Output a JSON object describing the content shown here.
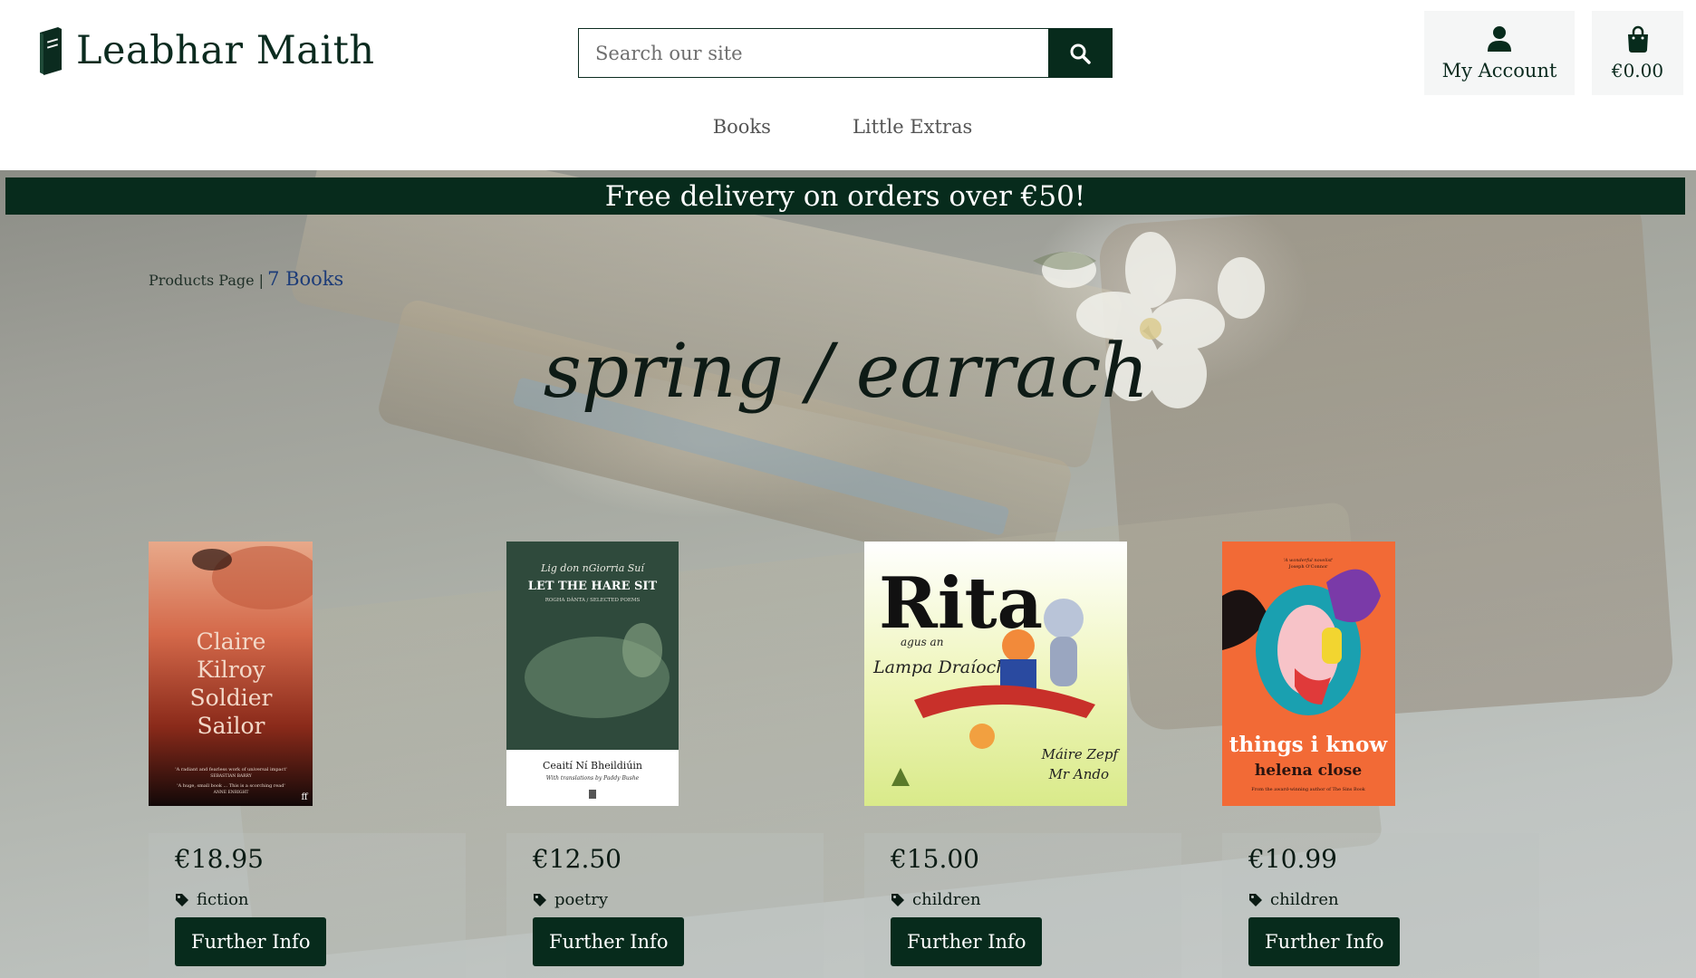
{
  "brand": {
    "name": "Leabhar Maith"
  },
  "search": {
    "placeholder": "Search our site"
  },
  "account": {
    "label": "My Account"
  },
  "cart": {
    "total": "€0.00"
  },
  "nav": [
    {
      "label": "Books"
    },
    {
      "label": "Little Extras"
    }
  ],
  "banner": {
    "text": "Free delivery on orders over €50!"
  },
  "breadcrumb": {
    "page": "Products Page |",
    "count": "7 Books"
  },
  "page_title": "spring / earrach",
  "products": [
    {
      "price": "€18.95",
      "tag": "fiction",
      "button": "Further Info",
      "cover": {
        "title_lines": [
          "Claire",
          "Kilroy",
          "Soldier",
          "Sailor"
        ],
        "quote1": "'A radiant and fearless work of universal impact'",
        "quote1_by": "SEBASTIAN BARRY",
        "quote2": "'A huge, small book ... This is a scorching read'",
        "quote2_by": "ANNE ENRIGHT"
      }
    },
    {
      "price": "€12.50",
      "tag": "poetry",
      "button": "Further Info",
      "cover": {
        "irish_title": "Lig don nGiorria Suí",
        "title": "LET THE HARE SIT",
        "subtitle": "ROGHA DÁNTA / SELECTED POEMS",
        "author": "Ceaití Ní Bheildiúin",
        "translator": "With translations by Paddy Bushe"
      }
    },
    {
      "price": "€15.00",
      "tag": "children",
      "button": "Further Info",
      "cover": {
        "title": "Rita",
        "sub1": "agus an",
        "sub2": "Lampa Draíochta",
        "author1": "Máire Zepf",
        "author2": "Mr Ando"
      }
    },
    {
      "price": "€10.99",
      "tag": "children",
      "button": "Further Info",
      "cover": {
        "quote": "'A wonderful novelist'",
        "quote_by": "Joseph O'Connor",
        "title": "things i know",
        "author": "helena close",
        "footer": "From the award-winning author of The Sins Book"
      }
    }
  ],
  "colors": {
    "brand_green": "#072b1c",
    "accent_underline": "#e2a21a",
    "breadcrumb_link": "#1d3c78"
  }
}
